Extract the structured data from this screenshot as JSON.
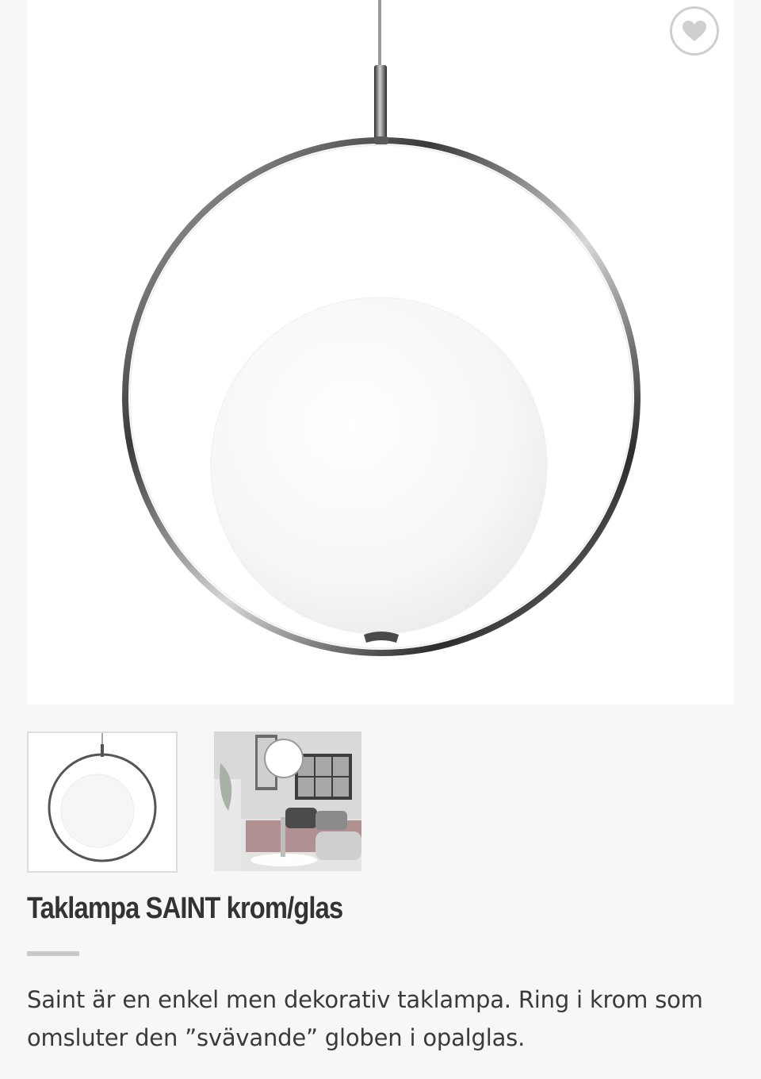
{
  "product": {
    "title": "Taklampa SAINT krom/glas",
    "description": "Saint är en enkel men dekorativ taklampa. Ring i krom som omsluter den ”svävande” globen i opalglas."
  },
  "gallery": {
    "selected_index": 0,
    "thumbnails": [
      {
        "icon": "lamp-product-photo"
      },
      {
        "icon": "room-interior-photo"
      }
    ]
  },
  "actions": {
    "favorite_icon": "heart-icon"
  },
  "colors": {
    "background": "#f7f7f7",
    "panel": "#ffffff",
    "title_text": "#333333",
    "divider": "#c9c9c9",
    "icon_gray": "#cfcfcf"
  }
}
